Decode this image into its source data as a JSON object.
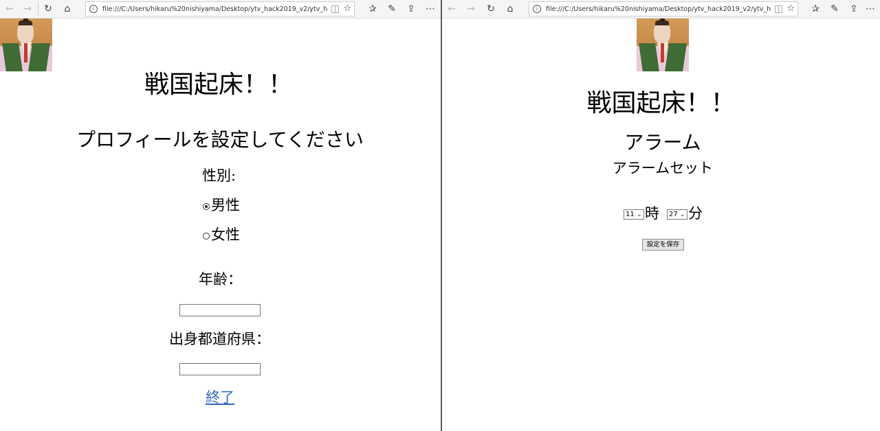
{
  "browser": {
    "left_url": "file:///C:/Users/hikaru%20nishiyama/Desktop/ytv_hack2019_v2/ytv_hack2019_",
    "right_url": "file:///C:/Users/hikaru%20nishiyama/Desktop/ytv_hack2019_v2/ytv_hack2019_",
    "icons": {
      "back": "←",
      "forward": "→",
      "refresh": "↻",
      "home": "⌂",
      "favorite": "☆",
      "favorites_hub": "✰",
      "notes": "✎",
      "share": "⇪",
      "more": "⋯"
    }
  },
  "profile_page": {
    "title": "戦国起床！！",
    "heading": "プロフィールを設定してください",
    "gender_label": "性別:",
    "gender_options": [
      {
        "label": "男性",
        "checked": true
      },
      {
        "label": "女性",
        "checked": false
      }
    ],
    "age_label": "年齢：",
    "age_value": "",
    "prefecture_label": "出身都道府県：",
    "prefecture_value": "",
    "finish_link": "終了"
  },
  "alarm_page": {
    "title": "戦国起床！！",
    "heading": "アラーム",
    "subheading": "アラームセット",
    "hour_value": "11",
    "hour_unit": "時",
    "minute_value": "27",
    "minute_unit": "分",
    "save_button": "設定を保存"
  }
}
